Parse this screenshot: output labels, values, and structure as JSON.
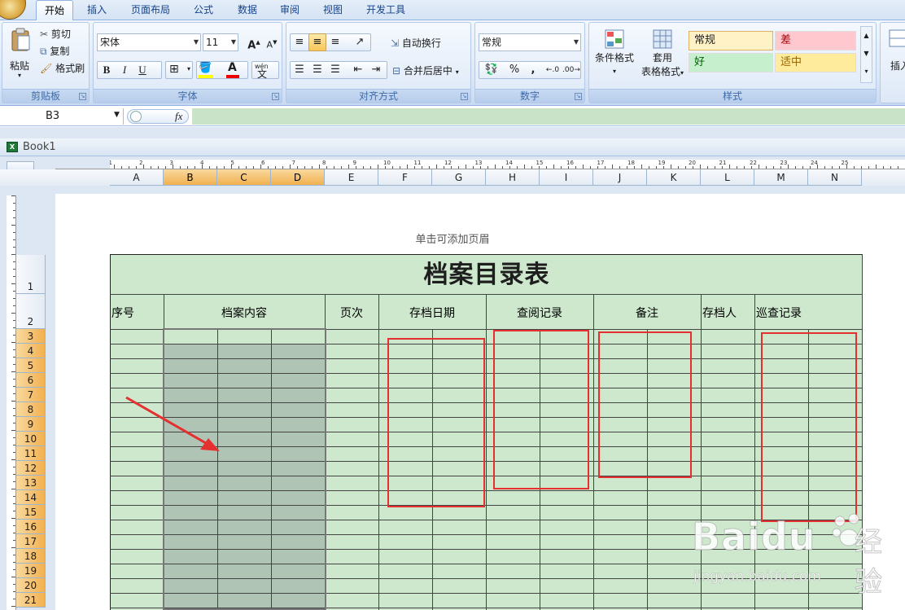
{
  "tabs": [
    "开始",
    "插入",
    "页面布局",
    "公式",
    "数据",
    "审阅",
    "视图",
    "开发工具"
  ],
  "ribbon": {
    "clipboard": {
      "paste": "粘贴",
      "cut": "剪切",
      "copy": "复制",
      "format_painter": "格式刷",
      "title": "剪贴板"
    },
    "font": {
      "name": "宋体",
      "size": "11",
      "bold": "B",
      "italic": "I",
      "underline": "U",
      "title": "字体",
      "grow": "A",
      "shrink": "A",
      "font_color_glyph": "A",
      "phonetic": "wén"
    },
    "alignment": {
      "wrap": "自动换行",
      "merge": "合并后居中",
      "title": "对齐方式"
    },
    "number": {
      "format": "常规",
      "percent": "%",
      "comma": ",",
      "title": "数字"
    },
    "styles": {
      "conditional": "条件格式",
      "table_format_1": "套用",
      "table_format_2": "表格格式",
      "normal": "常规",
      "bad": "差",
      "good": "好",
      "neutral": "适中",
      "title": "样式"
    },
    "cells": {
      "insert": "插入"
    }
  },
  "formula_bar": {
    "name_box": "B3",
    "fx": "fx",
    "value": ""
  },
  "workbook": {
    "name": "Book1"
  },
  "sheet": {
    "columns": [
      "A",
      "B",
      "C",
      "D",
      "E",
      "F",
      "G",
      "H",
      "I",
      "J",
      "K",
      "L",
      "M",
      "N"
    ],
    "selected_columns": [
      "B",
      "C",
      "D"
    ],
    "rows": [
      "1",
      "2",
      "3",
      "4",
      "5",
      "6",
      "7",
      "8",
      "9",
      "10",
      "11",
      "12",
      "13",
      "14",
      "15",
      "16",
      "17",
      "18",
      "19",
      "20",
      "21"
    ],
    "selected_rows_from": 3,
    "header_hint": "单击可添加页眉",
    "title": "档案目录表",
    "headers": [
      "序号",
      "档案内容",
      "页次",
      "存档日期",
      "查阅记录",
      "备注",
      "存档人",
      "巡查记录"
    ],
    "ruler_numbers": [
      "1",
      "1",
      "2",
      "3",
      "4",
      "5",
      "6",
      "7",
      "8",
      "9",
      "10",
      "11",
      "12",
      "13",
      "14",
      "15",
      "16",
      "17",
      "18",
      "19",
      "20",
      "21",
      "22",
      "23",
      "24",
      "25"
    ]
  },
  "watermark": {
    "brand": "Baidu",
    "text": "经验",
    "url": "jingyan.baidu.com"
  },
  "colors": {
    "sheet_fill": "#cde8cd",
    "selection": "#b0c4b6",
    "highlight_box": "#e53030",
    "arrow": "#e53030"
  }
}
